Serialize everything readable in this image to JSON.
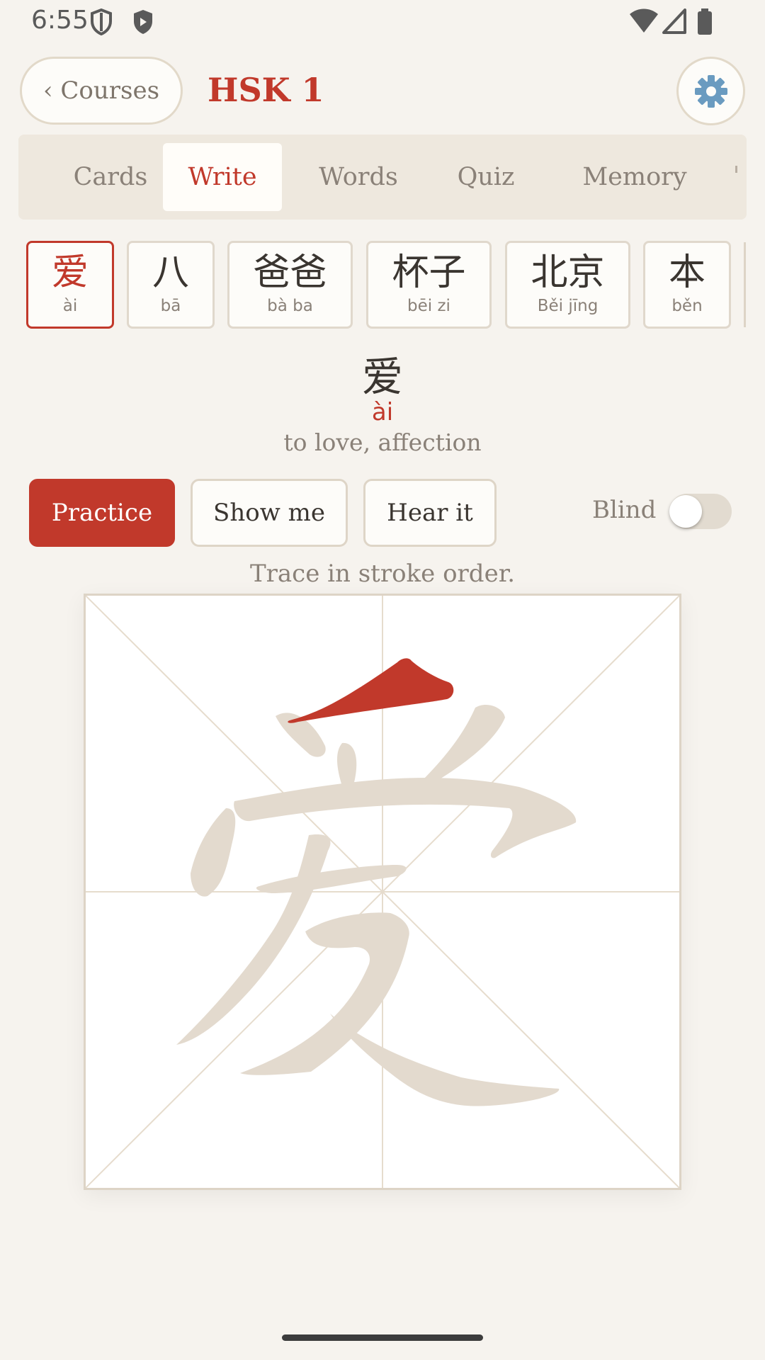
{
  "status_bar": {
    "time": "6:55"
  },
  "header": {
    "back_label": "‹ Courses",
    "title": "HSK 1",
    "settings_icon": "gear-icon"
  },
  "tabs": [
    {
      "label": "Cards"
    },
    {
      "label": "Write",
      "active": true
    },
    {
      "label": "Words"
    },
    {
      "label": "Quiz"
    },
    {
      "label": "Memory"
    }
  ],
  "words": [
    {
      "hanzi": "爱",
      "pinyin": "ài",
      "selected": true
    },
    {
      "hanzi": "八",
      "pinyin": "bā"
    },
    {
      "hanzi": "爸爸",
      "pinyin": "bà ba"
    },
    {
      "hanzi": "杯子",
      "pinyin": "bēi zi"
    },
    {
      "hanzi": "北京",
      "pinyin": "Běi jīng"
    },
    {
      "hanzi": "本",
      "pinyin": "běn"
    }
  ],
  "current": {
    "hanzi": "爱",
    "pinyin": "ài",
    "definition": "to love, affection"
  },
  "controls": {
    "practice": "Practice",
    "show_me": "Show me",
    "hear_it": "Hear it",
    "blind_label": "Blind",
    "blind_on": false
  },
  "hint": "Trace in stroke order.",
  "colors": {
    "accent": "#c1392b",
    "background": "#f6f3ee",
    "stroke_ghost": "#e3dace",
    "grid": "#e6dccd"
  }
}
